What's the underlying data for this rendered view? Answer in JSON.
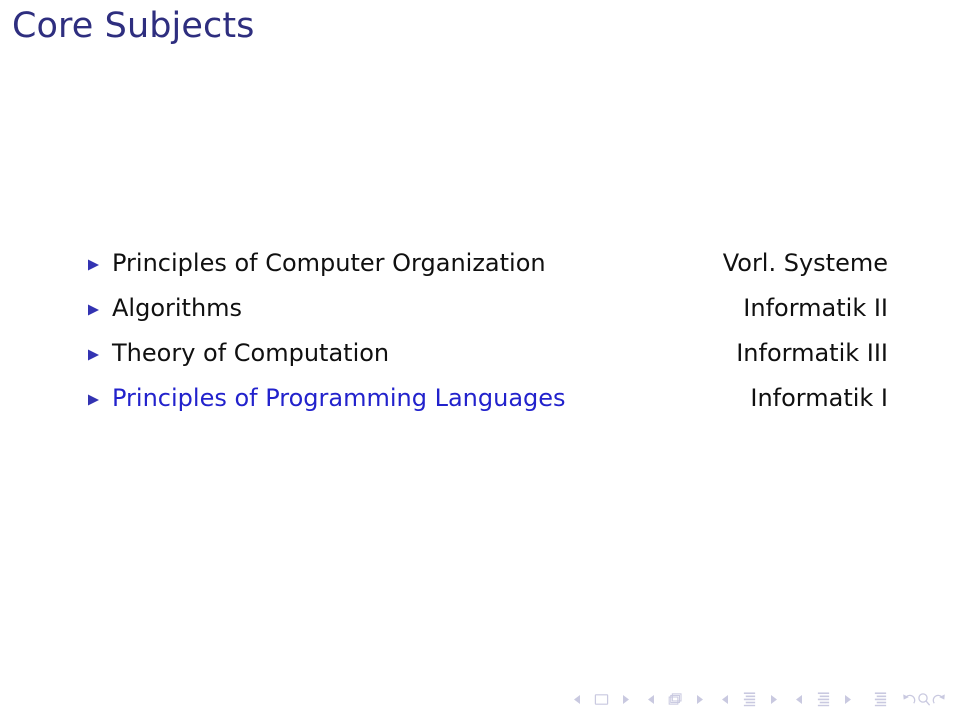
{
  "slide": {
    "title": "Core Subjects",
    "title_color": "#2e2e7f",
    "background_color": "#ffffff",
    "body_text_color": "#101010",
    "highlight_color": "#2222cc",
    "bullet_color": "#3333b2",
    "nav_color": "#c9c9e0"
  },
  "items": [
    {
      "label": "Principles of Computer Organization",
      "course": "Vorl. Systeme",
      "highlighted": false
    },
    {
      "label": "Algorithms",
      "course": "Informatik II",
      "highlighted": false
    },
    {
      "label": "Theory of Computation",
      "course": "Informatik III",
      "highlighted": false
    },
    {
      "label": "Principles of Programming Languages",
      "course": "Informatik I",
      "highlighted": true
    }
  ],
  "navigation": {
    "groups": [
      {
        "name": "slide-navigation",
        "prev_label": "previous-slide",
        "target_label": "slide",
        "next_label": "next-slide"
      },
      {
        "name": "frame-navigation",
        "prev_label": "previous-frame",
        "target_label": "frame",
        "next_label": "next-frame"
      },
      {
        "name": "subsection-navigation",
        "prev_label": "previous-subsection",
        "target_label": "subsection",
        "next_label": "next-subsection"
      },
      {
        "name": "section-navigation",
        "prev_label": "previous-section",
        "target_label": "section",
        "next_label": "next-section"
      }
    ],
    "presentation_label": "presentation",
    "back_label": "go-back",
    "search_label": "search",
    "forward_label": "go-forward"
  }
}
